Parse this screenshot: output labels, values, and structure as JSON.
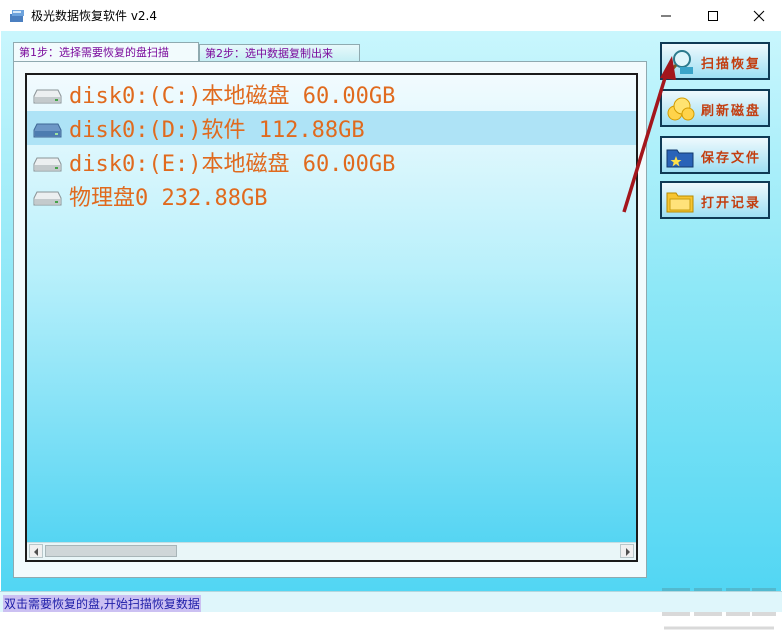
{
  "window": {
    "title": "极光数据恢复软件 v2.4",
    "icon": "app-disk-icon",
    "controls": [
      "minimize-icon",
      "maximize-icon",
      "close-icon"
    ]
  },
  "tabs": [
    {
      "label": "第1步：选择需要恢复的盘扫描",
      "active": true
    },
    {
      "label": "第2步：选中数据复制出来",
      "active": false
    }
  ],
  "disks": [
    {
      "label": "disk0:(C:)本地磁盘 60.00GB",
      "selected": false,
      "icon": "drive-icon"
    },
    {
      "label": "disk0:(D:)软件 112.88GB",
      "selected": true,
      "icon": "drive-icon"
    },
    {
      "label": "disk0:(E:)本地磁盘 60.00GB",
      "selected": false,
      "icon": "drive-icon"
    },
    {
      "label": "物理盘0 232.88GB",
      "selected": false,
      "icon": "drive-icon"
    }
  ],
  "actions": [
    {
      "label": "扫描恢复",
      "icon": "magnifier-icon"
    },
    {
      "label": "刷新磁盘",
      "icon": "refresh-icon"
    },
    {
      "label": "保存文件",
      "icon": "save-icon"
    },
    {
      "label": "打开记录",
      "icon": "folder-icon"
    }
  ],
  "status": {
    "text": "双击需要恢复的盘,开始扫描恢复数据"
  },
  "colors": {
    "disk_text": "#e06a1e",
    "button_text": "#c33e10",
    "tab_text": "#7a0a9c",
    "annotation_arrow": "#a3161c",
    "status_text": "#1d1da8"
  }
}
